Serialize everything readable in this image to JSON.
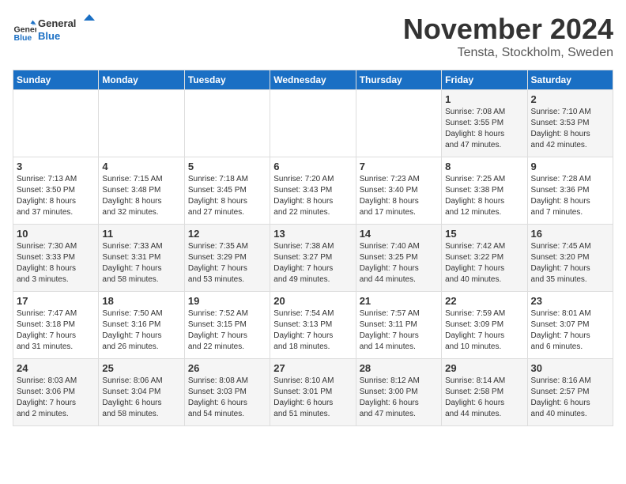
{
  "logo": {
    "line1": "General",
    "line2": "Blue"
  },
  "title": "November 2024",
  "location": "Tensta, Stockholm, Sweden",
  "headers": [
    "Sunday",
    "Monday",
    "Tuesday",
    "Wednesday",
    "Thursday",
    "Friday",
    "Saturday"
  ],
  "weeks": [
    [
      {
        "day": "",
        "info": ""
      },
      {
        "day": "",
        "info": ""
      },
      {
        "day": "",
        "info": ""
      },
      {
        "day": "",
        "info": ""
      },
      {
        "day": "",
        "info": ""
      },
      {
        "day": "1",
        "info": "Sunrise: 7:08 AM\nSunset: 3:55 PM\nDaylight: 8 hours\nand 47 minutes."
      },
      {
        "day": "2",
        "info": "Sunrise: 7:10 AM\nSunset: 3:53 PM\nDaylight: 8 hours\nand 42 minutes."
      }
    ],
    [
      {
        "day": "3",
        "info": "Sunrise: 7:13 AM\nSunset: 3:50 PM\nDaylight: 8 hours\nand 37 minutes."
      },
      {
        "day": "4",
        "info": "Sunrise: 7:15 AM\nSunset: 3:48 PM\nDaylight: 8 hours\nand 32 minutes."
      },
      {
        "day": "5",
        "info": "Sunrise: 7:18 AM\nSunset: 3:45 PM\nDaylight: 8 hours\nand 27 minutes."
      },
      {
        "day": "6",
        "info": "Sunrise: 7:20 AM\nSunset: 3:43 PM\nDaylight: 8 hours\nand 22 minutes."
      },
      {
        "day": "7",
        "info": "Sunrise: 7:23 AM\nSunset: 3:40 PM\nDaylight: 8 hours\nand 17 minutes."
      },
      {
        "day": "8",
        "info": "Sunrise: 7:25 AM\nSunset: 3:38 PM\nDaylight: 8 hours\nand 12 minutes."
      },
      {
        "day": "9",
        "info": "Sunrise: 7:28 AM\nSunset: 3:36 PM\nDaylight: 8 hours\nand 7 minutes."
      }
    ],
    [
      {
        "day": "10",
        "info": "Sunrise: 7:30 AM\nSunset: 3:33 PM\nDaylight: 8 hours\nand 3 minutes."
      },
      {
        "day": "11",
        "info": "Sunrise: 7:33 AM\nSunset: 3:31 PM\nDaylight: 7 hours\nand 58 minutes."
      },
      {
        "day": "12",
        "info": "Sunrise: 7:35 AM\nSunset: 3:29 PM\nDaylight: 7 hours\nand 53 minutes."
      },
      {
        "day": "13",
        "info": "Sunrise: 7:38 AM\nSunset: 3:27 PM\nDaylight: 7 hours\nand 49 minutes."
      },
      {
        "day": "14",
        "info": "Sunrise: 7:40 AM\nSunset: 3:25 PM\nDaylight: 7 hours\nand 44 minutes."
      },
      {
        "day": "15",
        "info": "Sunrise: 7:42 AM\nSunset: 3:22 PM\nDaylight: 7 hours\nand 40 minutes."
      },
      {
        "day": "16",
        "info": "Sunrise: 7:45 AM\nSunset: 3:20 PM\nDaylight: 7 hours\nand 35 minutes."
      }
    ],
    [
      {
        "day": "17",
        "info": "Sunrise: 7:47 AM\nSunset: 3:18 PM\nDaylight: 7 hours\nand 31 minutes."
      },
      {
        "day": "18",
        "info": "Sunrise: 7:50 AM\nSunset: 3:16 PM\nDaylight: 7 hours\nand 26 minutes."
      },
      {
        "day": "19",
        "info": "Sunrise: 7:52 AM\nSunset: 3:15 PM\nDaylight: 7 hours\nand 22 minutes."
      },
      {
        "day": "20",
        "info": "Sunrise: 7:54 AM\nSunset: 3:13 PM\nDaylight: 7 hours\nand 18 minutes."
      },
      {
        "day": "21",
        "info": "Sunrise: 7:57 AM\nSunset: 3:11 PM\nDaylight: 7 hours\nand 14 minutes."
      },
      {
        "day": "22",
        "info": "Sunrise: 7:59 AM\nSunset: 3:09 PM\nDaylight: 7 hours\nand 10 minutes."
      },
      {
        "day": "23",
        "info": "Sunrise: 8:01 AM\nSunset: 3:07 PM\nDaylight: 7 hours\nand 6 minutes."
      }
    ],
    [
      {
        "day": "24",
        "info": "Sunrise: 8:03 AM\nSunset: 3:06 PM\nDaylight: 7 hours\nand 2 minutes."
      },
      {
        "day": "25",
        "info": "Sunrise: 8:06 AM\nSunset: 3:04 PM\nDaylight: 6 hours\nand 58 minutes."
      },
      {
        "day": "26",
        "info": "Sunrise: 8:08 AM\nSunset: 3:03 PM\nDaylight: 6 hours\nand 54 minutes."
      },
      {
        "day": "27",
        "info": "Sunrise: 8:10 AM\nSunset: 3:01 PM\nDaylight: 6 hours\nand 51 minutes."
      },
      {
        "day": "28",
        "info": "Sunrise: 8:12 AM\nSunset: 3:00 PM\nDaylight: 6 hours\nand 47 minutes."
      },
      {
        "day": "29",
        "info": "Sunrise: 8:14 AM\nSunset: 2:58 PM\nDaylight: 6 hours\nand 44 minutes."
      },
      {
        "day": "30",
        "info": "Sunrise: 8:16 AM\nSunset: 2:57 PM\nDaylight: 6 hours\nand 40 minutes."
      }
    ]
  ]
}
